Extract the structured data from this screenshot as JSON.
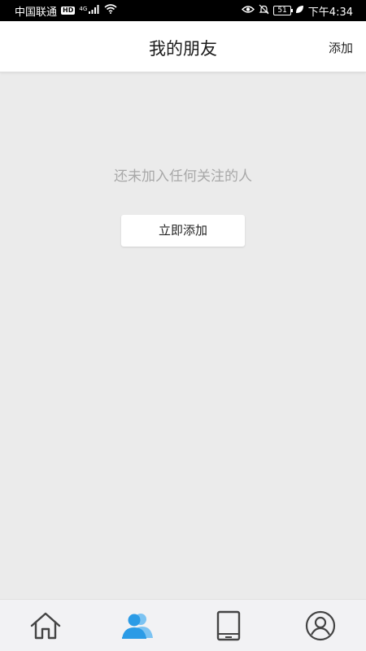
{
  "status_bar": {
    "carrier": "中国联通",
    "hd": "HD",
    "network": "4G",
    "battery": "51",
    "time": "下午4:34"
  },
  "header": {
    "title": "我的朋友",
    "add_label": "添加"
  },
  "empty_state": {
    "message": "还未加入任何关注的人",
    "button_label": "立即添加"
  },
  "tabs": [
    {
      "icon": "home-icon",
      "active": false
    },
    {
      "icon": "friends-icon",
      "active": true
    },
    {
      "icon": "tablet-icon",
      "active": false
    },
    {
      "icon": "user-profile-icon",
      "active": false
    }
  ],
  "colors": {
    "active_tab": "#2b9be6",
    "inactive_tab": "#444444",
    "background": "#ebebeb",
    "empty_text": "#a8a8a8"
  }
}
